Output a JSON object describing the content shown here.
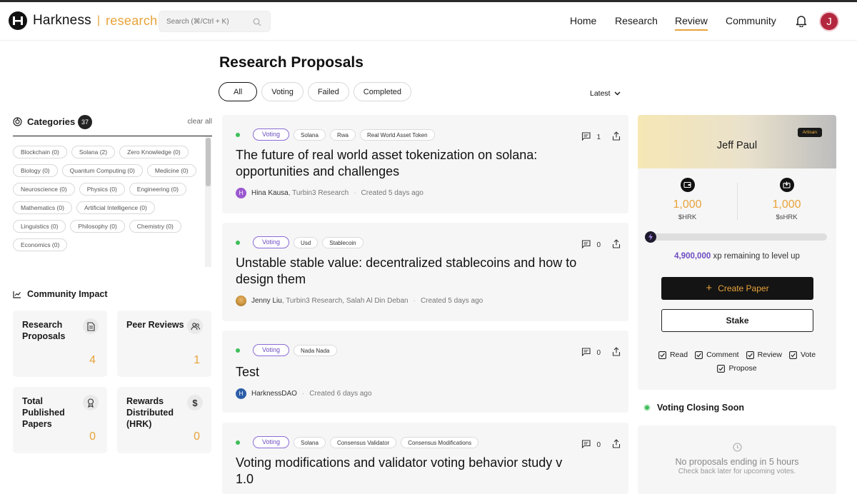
{
  "header": {
    "brand": "Harkness",
    "brand_sep": "|",
    "brand_sub": "research",
    "search_placeholder": "Search (⌘/Ctrl + K)",
    "nav": [
      "Home",
      "Research",
      "Review",
      "Community"
    ],
    "active_nav": "Review",
    "avatar_initial": "J",
    "accent_color": "#e8a33a"
  },
  "page": {
    "title": "Research Proposals",
    "tabs": [
      "All",
      "Voting",
      "Failed",
      "Completed"
    ],
    "active_tab": "All",
    "sort": "Latest"
  },
  "categories": {
    "title": "Categories",
    "count": "37",
    "clear_label": "clear all",
    "items": [
      "Blockchain (0)",
      "Solana (2)",
      "Zero Knowledge (0)",
      "Biology (0)",
      "Quantum Computing (0)",
      "Medicine (0)",
      "Neuroscience (0)",
      "Physics (0)",
      "Engineering (0)",
      "Mathematics (0)",
      "Artificial Intelligence (0)",
      "Linguistics (0)",
      "Philosophy (0)",
      "Chemistry (0)",
      "Economics (0)"
    ]
  },
  "impact": {
    "title": "Community Impact",
    "stats": [
      {
        "label": "Research Proposals",
        "value": "4"
      },
      {
        "label": "Peer Reviews",
        "value": "1"
      },
      {
        "label": "Total Published Papers",
        "value": "0"
      },
      {
        "label": "Rewards Distributed (HRK)",
        "value": "0"
      }
    ]
  },
  "proposals": [
    {
      "status": "Voting",
      "tags": [
        "Solana",
        "Rwa",
        "Real World Asset Token"
      ],
      "comments": "1",
      "title": "The future of real world asset tokenization on solana: opportunities and challenges",
      "author": "Hina Kausa",
      "affiliation": ", Turbin3 Research",
      "sep": "·",
      "created": "Created 5 days ago",
      "avatar_initial": "H",
      "avatar_color": "#9b59d0"
    },
    {
      "status": "Voting",
      "tags": [
        "Usd",
        "Stablecoin"
      ],
      "comments": "0",
      "title": "Unstable stable value: decentralized stablecoins and how to design them",
      "author": "Jenny Liu",
      "affiliation": ", Turbin3 Research, Salah Al Din Deban",
      "sep": "·",
      "created": "Created 5 days ago",
      "avatar_initial": "",
      "avatar_color": "#c8923c"
    },
    {
      "status": "Voting",
      "tags": [
        "Nada Nada"
      ],
      "comments": "0",
      "title": "Test",
      "author": "HarknessDAO",
      "affiliation": "",
      "sep": "·",
      "created": "Created 6 days ago",
      "avatar_initial": "H",
      "avatar_color": "#2d5ea8"
    },
    {
      "status": "Voting",
      "tags": [
        "Solana",
        "Consensus Validator",
        "Consensus Modifications"
      ],
      "comments": "0",
      "title": "Voting modifications and validator voting behavior study v 1.0",
      "author": "",
      "affiliation": "",
      "sep": "",
      "created": "",
      "avatar_initial": "",
      "avatar_color": ""
    }
  ],
  "profile": {
    "name": "Jeff Paul",
    "badge": "Artisan",
    "hrk_value": "1,000",
    "hrk_unit": "$HRK",
    "shrk_value": "1,000",
    "shrk_unit": "$sHRK",
    "xp_value": "4,900,000",
    "xp_suffix": " xp remaining to level up",
    "create_label": "Create Paper",
    "stake_label": "Stake",
    "permissions": [
      "Read",
      "Comment",
      "Review",
      "Vote",
      "Propose"
    ]
  },
  "closing": {
    "title": "Voting Closing Soon",
    "empty_title": "No proposals ending in 5 hours",
    "empty_sub": "Check back later for upcoming votes."
  }
}
